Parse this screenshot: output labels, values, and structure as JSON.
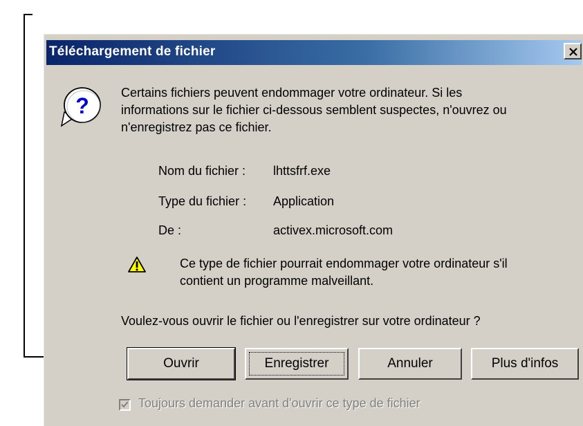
{
  "dialog": {
    "title": "Téléchargement de fichier",
    "intro_lines": [
      "Certains fichiers peuvent endommager votre ordinateur. Si les",
      "informations sur le fichier ci-dessous semblent suspectes, n'ouvrez ou",
      "n'enregistrez pas ce fichier."
    ],
    "file_info": [
      {
        "label": "Nom du fichier :",
        "value": "lhttsfrf.exe"
      },
      {
        "label": "Type du fichier :",
        "value": "Application"
      },
      {
        "label": "De :",
        "value": "activex.microsoft.com"
      }
    ],
    "warning_lines": [
      "Ce type de fichier pourrait endommager votre ordinateur s'il",
      "contient un programme malveillant."
    ],
    "question": "Voulez-vous ouvrir le fichier ou l'enregistrer sur votre ordinateur ?",
    "buttons": {
      "open": "Ouvrir",
      "save": "Enregistrer",
      "cancel": "Annuler",
      "more_info": "Plus d'infos"
    },
    "checkbox": {
      "label": "Toujours demander avant d'ouvrir ce type de fichier",
      "checked": true,
      "disabled": true
    }
  },
  "icons": {
    "close": "close-icon",
    "question": "question-icon",
    "warning": "warning-icon"
  },
  "colors": {
    "title_bar_start": "#0a246a",
    "title_bar_end": "#a6caf0",
    "dialog_bg": "#d4d0c8",
    "disabled_text": "#808080"
  }
}
